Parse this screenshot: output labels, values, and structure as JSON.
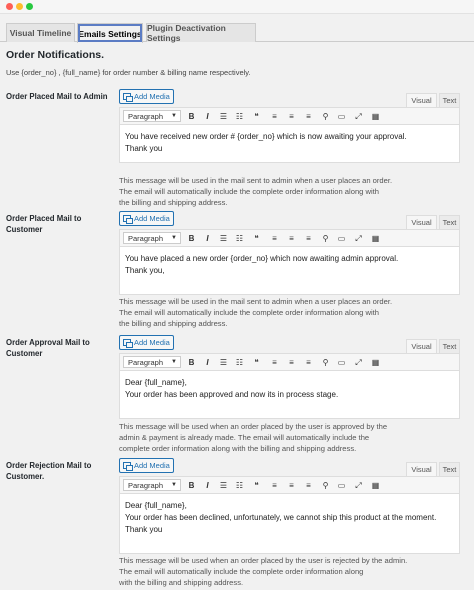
{
  "window": {
    "controls": {
      "close_color": "#fe5f57",
      "minimize_color": "#febc2e",
      "zoom_color": "#28c840"
    }
  },
  "tabs": [
    {
      "label": "Visual Timeline"
    },
    {
      "label": "Emails Settings",
      "active": true
    },
    {
      "label": "Plugin Deactivation Settings"
    }
  ],
  "heading": "Order Notifications.",
  "description": "Use {order_no} , {full_name} for order number & billing name respectively.",
  "editor_common": {
    "add_media": "Add Media",
    "visual_tab": "Visual",
    "text_tab": "Text",
    "format_select": "Paragraph",
    "toolbar_icons": [
      "bold-icon",
      "italic-icon",
      "bullet-list-icon",
      "numbered-list-icon",
      "blockquote-icon",
      "align-left-icon",
      "align-center-icon",
      "align-right-icon",
      "link-icon",
      "read-more-icon",
      "fullscreen-icon",
      "toolbar-toggle-icon"
    ]
  },
  "settings": [
    {
      "label": "Order Placed Mail to Admin",
      "lines": [
        "You have received new order # {order_no} which is now awaiting your approval.",
        "Thank you"
      ],
      "help": [
        "This message will be used in the mail sent to admin when a user places an order.",
        "The email will automatically include the complete order information along with",
        "the billing and shipping address."
      ]
    },
    {
      "label": "Order Placed Mail to Customer",
      "lines": [
        "You have placed a new order {order_no} which now awaiting admin approval.",
        "Thank you,"
      ],
      "help": [
        "This message will be used in the mail sent to admin when a user places an order.",
        "The email will automatically include the complete order information along with",
        "the billing and shipping address."
      ]
    },
    {
      "label": "Order Approval Mail to Customer",
      "lines": [
        "Dear {full_name},",
        "Your order has been approved and now its in process stage."
      ],
      "help": [
        "This message will be used when an order placed by the user is approved by the",
        "admin & payment is already made. The email will automatically include the",
        "complete order information along with the billing and shipping address."
      ]
    },
    {
      "label": "Order Rejection Mail to Customer.",
      "lines": [
        "Dear {full_name},",
        "Your order has been declined, unfortunately, we cannot ship this product at the moment.",
        "Thank you"
      ],
      "help": [
        "This message will be used when an order placed by the user is rejected by the admin.",
        "The email will automatically include the complete order information along",
        "with the billing and shipping address."
      ]
    }
  ]
}
